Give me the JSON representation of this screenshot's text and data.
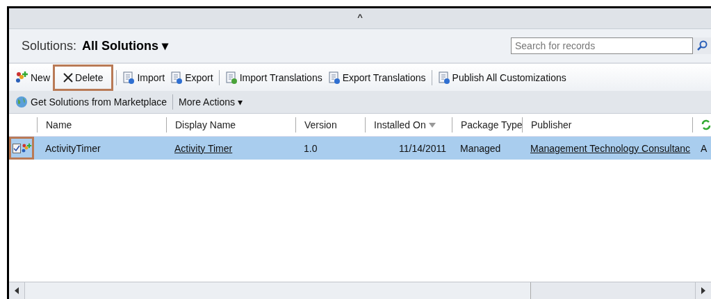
{
  "collapse_toggle": "^",
  "header": {
    "label": "Solutions:",
    "view": "All Solutions",
    "view_caret": "▾"
  },
  "search": {
    "placeholder": "Search for records"
  },
  "toolbar_rows": [
    {
      "items": [
        {
          "kind": "new",
          "label": "New",
          "highlighted": false
        },
        {
          "kind": "delete",
          "label": "Delete",
          "highlighted": true
        },
        {
          "kind": "separator"
        },
        {
          "kind": "import",
          "label": "Import",
          "highlighted": false
        },
        {
          "kind": "export",
          "label": "Export",
          "highlighted": false
        },
        {
          "kind": "separator"
        },
        {
          "kind": "import_translations",
          "label": "Import Translations",
          "highlighted": false
        },
        {
          "kind": "export_translations",
          "label": "Export Translations",
          "highlighted": false
        },
        {
          "kind": "separator"
        },
        {
          "kind": "publish",
          "label": "Publish All Customizations",
          "highlighted": false
        }
      ]
    },
    {
      "items": [
        {
          "kind": "marketplace",
          "label": "Get Solutions from Marketplace",
          "highlighted": false
        },
        {
          "kind": "separator"
        },
        {
          "kind": "more",
          "label": "More Actions",
          "caret": "▾",
          "highlighted": false
        }
      ]
    }
  ],
  "table": {
    "columns": [
      {
        "label": "Name"
      },
      {
        "label": "Display Name"
      },
      {
        "label": "Version"
      },
      {
        "label": "Installed On",
        "sorted": true
      },
      {
        "label": "Package Type"
      },
      {
        "label": "Publisher"
      }
    ],
    "rows": [
      {
        "selected": true,
        "checked": true,
        "checkbox_highlighted": true,
        "cells": [
          "ActivityTimer",
          "Activity Timer",
          "1.0",
          "11/14/2011",
          "Managed",
          "Management Technology Consultanc",
          "A"
        ]
      }
    ]
  }
}
